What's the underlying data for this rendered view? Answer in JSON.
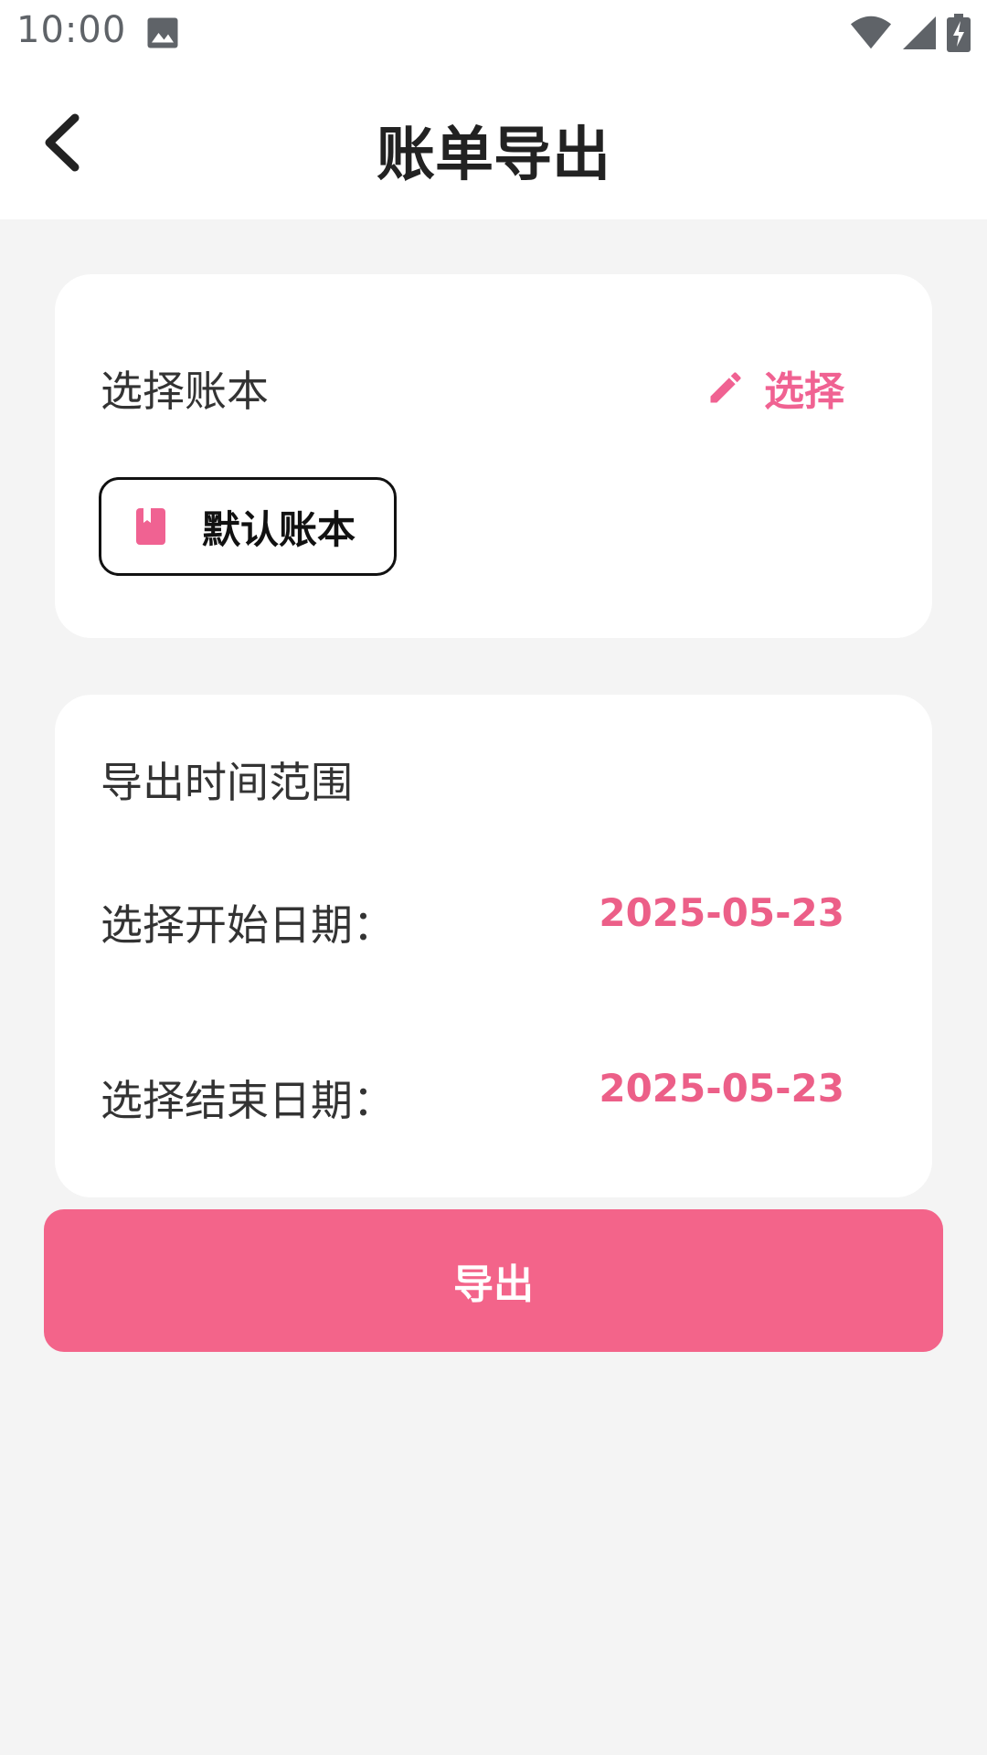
{
  "status_bar": {
    "time": "10:00",
    "icons": [
      "gallery-icon",
      "wifi-icon",
      "signal-icon",
      "battery-charging-icon"
    ]
  },
  "app_bar": {
    "title": "账单导出",
    "back_icon": "back-chevron-icon"
  },
  "book_card": {
    "label": "选择账本",
    "select_label": "选择",
    "select_icon": "edit-pencil-icon",
    "selected_book": "默认账本",
    "book_icon": "bookmark-book-icon"
  },
  "range_card": {
    "label": "导出时间范围",
    "start_label": "选择开始日期：",
    "start_date": "2025-05-23",
    "end_label": "选择结束日期：",
    "end_date": "2025-05-23"
  },
  "export_button": {
    "label": "导出"
  },
  "colors": {
    "accent": "#F06292",
    "button_bg": "#F3648A",
    "background": "#F4F4F4",
    "card": "#FFFFFF",
    "title_text": "#222222"
  }
}
